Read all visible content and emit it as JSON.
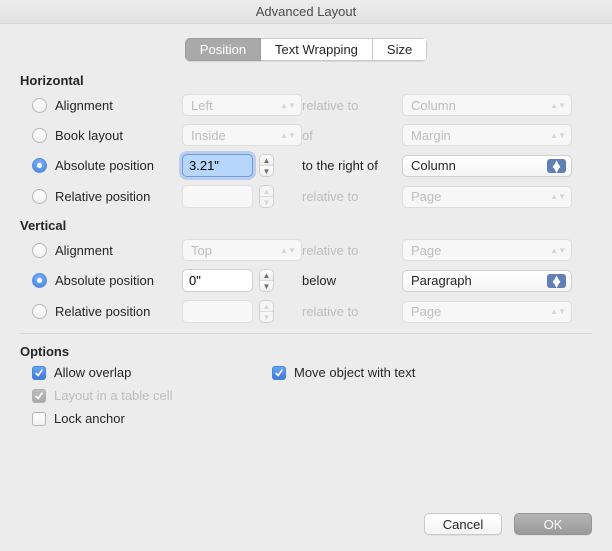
{
  "title": "Advanced Layout",
  "tabs": {
    "position": "Position",
    "wrap": "Text Wrapping",
    "size": "Size"
  },
  "horizontal": {
    "heading": "Horizontal",
    "rows": {
      "alignment": {
        "label": "Alignment",
        "value": "Left",
        "rel_label": "relative to",
        "rel_value": "Column"
      },
      "book": {
        "label": "Book layout",
        "value": "Inside",
        "rel_label": "of",
        "rel_value": "Margin"
      },
      "abs": {
        "label": "Absolute position",
        "value": "3.21\"",
        "rel_label": "to the right of",
        "rel_value": "Column"
      },
      "rel": {
        "label": "Relative position",
        "value": "",
        "rel_label": "relative to",
        "rel_value": "Page"
      }
    }
  },
  "vertical": {
    "heading": "Vertical",
    "rows": {
      "alignment": {
        "label": "Alignment",
        "value": "Top",
        "rel_label": "relative to",
        "rel_value": "Page"
      },
      "abs": {
        "label": "Absolute position",
        "value": "0\"",
        "rel_label": "below",
        "rel_value": "Paragraph"
      },
      "rel": {
        "label": "Relative position",
        "value": "",
        "rel_label": "relative to",
        "rel_value": "Page"
      }
    }
  },
  "options": {
    "heading": "Options",
    "overlap": "Allow overlap",
    "table": "Layout in a table cell",
    "lock": "Lock anchor",
    "move": "Move object with text"
  },
  "footer": {
    "cancel": "Cancel",
    "ok": "OK"
  }
}
